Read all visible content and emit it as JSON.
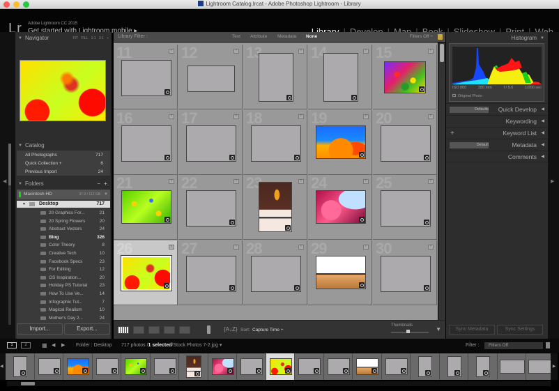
{
  "window": {
    "title": "Lightroom Catalog.lrcat - Adobe Photoshop Lightroom - Library"
  },
  "identity": {
    "logo": "Lr",
    "app_version": "Adobe Lightroom CC 2015",
    "promo": "Get started with Lightroom mobile ▸"
  },
  "modules": [
    {
      "label": "Library",
      "active": true
    },
    {
      "label": "Develop"
    },
    {
      "label": "Map"
    },
    {
      "label": "Book"
    },
    {
      "label": "Slideshow"
    },
    {
      "label": "Print"
    },
    {
      "label": "Web"
    }
  ],
  "navigator": {
    "title": "Navigator",
    "zoom_options": [
      "FIT",
      "FILL",
      "1:1",
      "3:1 ÷"
    ]
  },
  "catalog": {
    "title": "Catalog",
    "items": [
      {
        "label": "All Photographs",
        "count": "717"
      },
      {
        "label": "Quick Collection +",
        "count": "6"
      },
      {
        "label": "Previous Import",
        "count": "24"
      }
    ]
  },
  "folders": {
    "title": "Folders",
    "minus": "−",
    "plus": "+.",
    "volume": {
      "label": "Macintosh HD",
      "size": "37.2 / 112 GB"
    },
    "root": {
      "label": "Desktop",
      "count": "717"
    },
    "items": [
      {
        "label": "20 Graphics For...",
        "count": "21"
      },
      {
        "label": "20 Spring Flowers",
        "count": "20"
      },
      {
        "label": "Abstract Vectors",
        "count": "24"
      },
      {
        "label": "Blog",
        "count": "326",
        "bold": true
      },
      {
        "label": "Color Theory",
        "count": "8"
      },
      {
        "label": "Creative Tech",
        "count": "10"
      },
      {
        "label": "Facebook Specs",
        "count": "23"
      },
      {
        "label": "For Editing",
        "count": "12"
      },
      {
        "label": "GS Inspiration...",
        "count": "20"
      },
      {
        "label": "Holiday PS Tutorial",
        "count": "23"
      },
      {
        "label": "How To Use Ve...",
        "count": "14"
      },
      {
        "label": "Infographic Tut...",
        "count": "7"
      },
      {
        "label": "Magical Realism",
        "count": "10"
      },
      {
        "label": "Mother's Day 2...",
        "count": "24"
      }
    ]
  },
  "left_buttons": {
    "import": "Import...",
    "export": "Export..."
  },
  "filter_bar": {
    "label": "Library Filter :",
    "tabs": [
      "Text",
      "Attribute",
      "Metadata",
      "None"
    ],
    "active": "None",
    "status": "Filters Off ÷"
  },
  "grid": {
    "cells": [
      {
        "num": "11",
        "thumb": "blank"
      },
      {
        "num": "12",
        "thumb": "blank-wide"
      },
      {
        "num": "13",
        "thumb": "blank-tall"
      },
      {
        "num": "14",
        "thumb": "blank-tall"
      },
      {
        "num": "15",
        "thumb": "flowers-purple"
      },
      {
        "num": "16",
        "thumb": "blank"
      },
      {
        "num": "17",
        "thumb": "blank"
      },
      {
        "num": "18",
        "thumb": "blank"
      },
      {
        "num": "19",
        "thumb": "poppies-sky"
      },
      {
        "num": "20",
        "thumb": "blank"
      },
      {
        "num": "21",
        "thumb": "meadow-green"
      },
      {
        "num": "22",
        "thumb": "blank"
      },
      {
        "num": "23",
        "thumb": "tulip-wall"
      },
      {
        "num": "24",
        "thumb": "pink-blossom"
      },
      {
        "num": "25",
        "thumb": "blank"
      },
      {
        "num": "26",
        "thumb": "butterfly",
        "selected": true
      },
      {
        "num": "27",
        "thumb": "blank"
      },
      {
        "num": "28",
        "thumb": "blank"
      },
      {
        "num": "29",
        "thumb": "lighthouse"
      },
      {
        "num": "30",
        "thumb": "blank"
      }
    ]
  },
  "toolbar": {
    "sort_label": "Sort:",
    "sort_value": "Capture Time ÷",
    "thumbnails_label": "Thumbnails",
    "thumb_size": 0.45
  },
  "histogram": {
    "title": "Histogram",
    "iso": "ISO 800",
    "focal": "280 mm",
    "aperture": "f / 5.6",
    "shutter": "1/200 sec",
    "original_photo": "Original Photo"
  },
  "right_panels": [
    {
      "label": "Quick Develop",
      "select": "Defaults"
    },
    {
      "label": "Keywording"
    },
    {
      "label": "Keyword List",
      "plus": "+"
    },
    {
      "label": "Metadata",
      "select": "Default"
    },
    {
      "label": "Comments"
    }
  ],
  "sync": {
    "metadata": "Sync Metadata",
    "settings": "Sync Settings"
  },
  "filmstrip_bar": {
    "screen1": "1",
    "screen2": "2",
    "folder": "Folder : Desktop",
    "count": "717 photos /",
    "selected": "1 selected",
    "filename": "/Stock Photos 7-2.jpg ▾",
    "filter_label": "Filter :",
    "filter_value": "Filters Off"
  },
  "filmstrip": [
    "blank-tall",
    "blank",
    "poppies-sky",
    "blank",
    "meadow-green",
    "blank",
    "tulip-wall",
    "pink-blossom",
    "blank",
    "butterfly",
    "blank",
    "blank",
    "lighthouse",
    "blank",
    "blank-tall",
    "blank-tall",
    "blank-tall",
    "blank-wide",
    "blank-wide"
  ],
  "colors": {
    "accent_bg": "#2d2d2d",
    "grid_bg": "#999999",
    "selected_cell": "#c8c8c8"
  }
}
